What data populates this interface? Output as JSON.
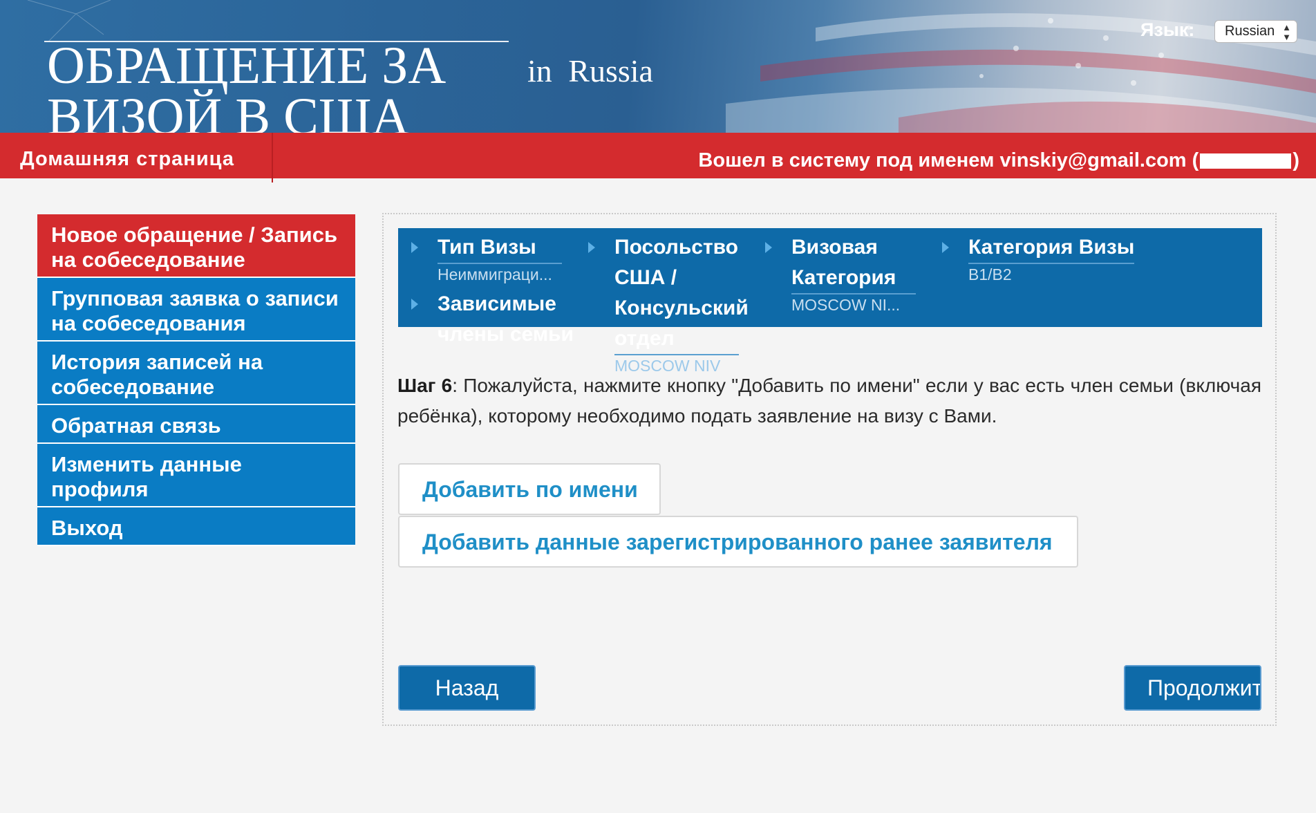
{
  "header": {
    "title": "ОБРАЩЕНИЕ ЗА ВИЗОЙ В США",
    "subtitle": "in  Russia",
    "language_label": "Язык:",
    "language_value": "Russian"
  },
  "navbar": {
    "home_label": "Домашняя страница",
    "logged_in_prefix": "Вошел в систему под именем",
    "user_email": "vinskiy@gmail.com",
    "paren_open": "(",
    "paren_close": ")"
  },
  "sidebar": {
    "items": [
      {
        "label": "Новое обращение / Запись на собеседование",
        "active": true
      },
      {
        "label": "Групповая заявка о записи на собеседования",
        "active": false
      },
      {
        "label": "История записей на собеседование",
        "active": false
      },
      {
        "label": "Обратная связь",
        "active": false
      },
      {
        "label": "Изменить данные профиля",
        "active": false
      },
      {
        "label": "Выход",
        "active": false
      }
    ]
  },
  "steps": [
    {
      "title": "Тип Визы",
      "value": "Неиммиграци..."
    },
    {
      "title": "Посольство США / Консульский отдел",
      "value": "MOSCOW NIV"
    },
    {
      "title": "Визовая Категория",
      "value": "MOSCOW NI..."
    },
    {
      "title": "Категория Визы",
      "value": "B1/B2"
    },
    {
      "title": "Зависимые члены семьи",
      "value": ""
    }
  ],
  "content": {
    "step_label": "Шаг 6",
    "step_text": ": Пожалуйста, нажмите кнопку \"Добавить по имени\" если у вас есть член семьи (включая ребёнка), которому необходимо подать заявление на визу с Вами."
  },
  "buttons": {
    "add_by_name": "Добавить по имени",
    "add_registered": "Добавить данные зарегистрированного ранее заявителя",
    "back": "Назад",
    "continue": "Продолжить"
  },
  "colors": {
    "red": "#d42b2e",
    "blue": "#0a7cc4",
    "dark_blue": "#0e6aa8",
    "link_blue": "#1f8fc7"
  }
}
